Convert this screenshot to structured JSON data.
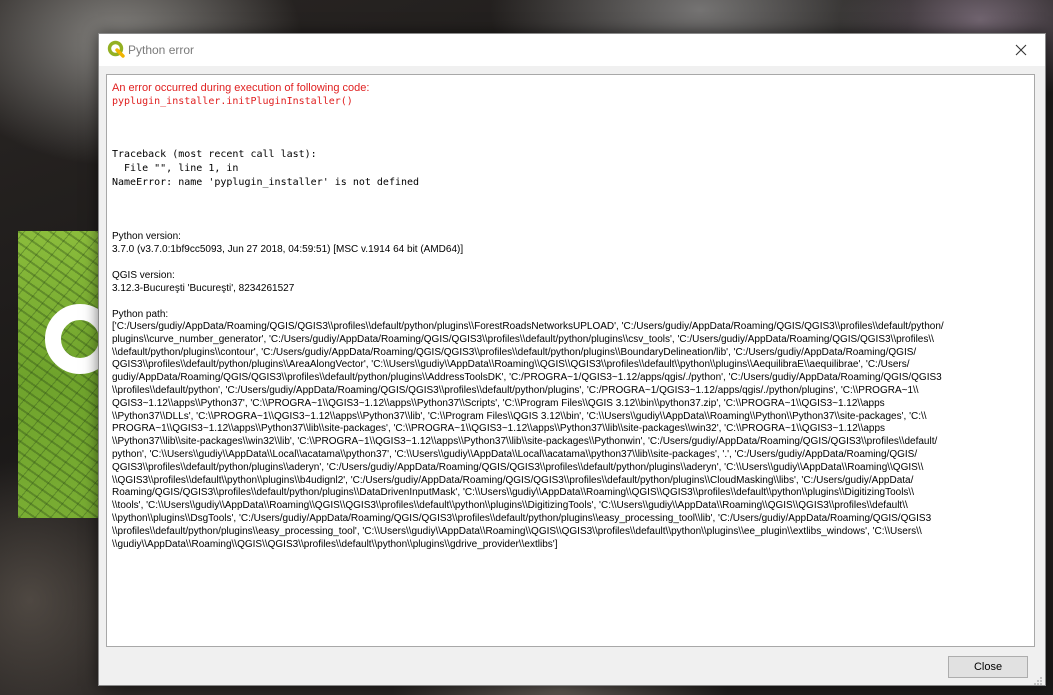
{
  "window": {
    "title": "Python error",
    "app_icon": "qgis-logo-icon",
    "close_icon": "close-icon"
  },
  "error": {
    "heading": "An error occurred during execution of following code:",
    "code": "pyplugin_installer.initPluginInstaller()"
  },
  "traceback": [
    "Traceback (most recent call last):",
    "  File \"\", line 1, in",
    "NameError: name 'pyplugin_installer' is not defined"
  ],
  "python_version": {
    "label": "Python version:",
    "value": "3.7.0 (v3.7.0:1bf9cc5093, Jun 27 2018, 04:59:51) [MSC v.1914 64 bit (AMD64)]"
  },
  "qgis_version": {
    "label": "QGIS version:",
    "value": "3.12.3-Bucureşti 'Bucureşti', 8234261527"
  },
  "python_path": {
    "label": "Python path:",
    "lines": [
      "['C:/Users/gudiy/AppData/Roaming/QGIS/QGIS3\\\\profiles\\\\default/python/plugins\\\\ForestRoadsNetworksUPLOAD', 'C:/Users/gudiy/AppData/Roaming/QGIS/QGIS3\\\\profiles\\\\default/python/",
      "plugins\\\\curve_number_generator', 'C:/Users/gudiy/AppData/Roaming/QGIS/QGIS3\\\\profiles\\\\default/python/plugins\\\\csv_tools', 'C:/Users/gudiy/AppData/Roaming/QGIS/QGIS3\\\\profiles\\\\",
      "\\\\default/python/plugins\\\\contour', 'C:/Users/gudiy/AppData/Roaming/QGIS/QGIS3\\\\profiles\\\\default/python/plugins\\\\BoundaryDelineation/lib', 'C:/Users/gudiy/AppData/Roaming/QGIS/",
      "QGIS3\\\\profiles\\\\default/python/plugins\\\\AreaAlongVector', 'C:\\\\Users\\\\gudiy\\\\AppData\\\\Roaming\\\\QGIS\\\\QGIS3\\\\profiles\\\\default\\\\python\\\\plugins\\\\AequilibraE\\\\aequilibrae', 'C:/Users/",
      "gudiy/AppData/Roaming/QGIS/QGIS3\\\\profiles\\\\default/python/plugins\\\\AddressToolsDK', 'C:/PROGRA~1/QGIS3~1.12/apps/qgis/./python', 'C:/Users/gudiy/AppData/Roaming/QGIS/QGIS3",
      "\\\\profiles\\\\default/python', 'C:/Users/gudiy/AppData/Roaming/QGIS/QGIS3\\\\profiles\\\\default/python/plugins', 'C:/PROGRA~1/QGIS3~1.12/apps/qgis/./python/plugins', 'C:\\\\PROGRA~1\\\\",
      "QGIS3~1.12\\\\apps\\\\Python37', 'C:\\\\PROGRA~1\\\\QGIS3~1.12\\\\apps\\\\Python37\\\\Scripts', 'C:\\\\Program Files\\\\QGIS 3.12\\\\bin\\\\python37.zip', 'C:\\\\PROGRA~1\\\\QGIS3~1.12\\\\apps",
      "\\\\Python37\\\\DLLs', 'C:\\\\PROGRA~1\\\\QGIS3~1.12\\\\apps\\\\Python37\\\\lib', 'C:\\\\Program Files\\\\QGIS 3.12\\\\bin', 'C:\\\\Users\\\\gudiy\\\\AppData\\\\Roaming\\\\Python\\\\Python37\\\\site-packages', 'C:\\\\",
      "PROGRA~1\\\\QGIS3~1.12\\\\apps\\\\Python37\\\\lib\\\\site-packages', 'C:\\\\PROGRA~1\\\\QGIS3~1.12\\\\apps\\\\Python37\\\\lib\\\\site-packages\\\\win32', 'C:\\\\PROGRA~1\\\\QGIS3~1.12\\\\apps",
      "\\\\Python37\\\\lib\\\\site-packages\\\\win32\\\\lib', 'C:\\\\PROGRA~1\\\\QGIS3~1.12\\\\apps\\\\Python37\\\\lib\\\\site-packages\\\\Pythonwin', 'C:/Users/gudiy/AppData/Roaming/QGIS/QGIS3\\\\profiles\\\\default/",
      "python', 'C:\\\\Users\\\\gudiy\\\\AppData\\\\Local\\\\acatama\\\\python37', 'C:\\\\Users\\\\gudiy\\\\AppData\\\\Local\\\\acatama\\\\python37\\\\lib\\\\site-packages', '.', 'C:/Users/gudiy/AppData/Roaming/QGIS/",
      "QGIS3\\\\profiles\\\\default/python/plugins\\\\aderyn', 'C:/Users/gudiy/AppData/Roaming/QGIS/QGIS3\\\\profiles\\\\default/python/plugins\\\\aderyn', 'C:\\\\Users\\\\gudiy\\\\AppData\\\\Roaming\\\\QGIS\\\\",
      "\\\\QGIS3\\\\profiles\\\\default\\\\python\\\\plugins\\\\b4udignl2', 'C:/Users/gudiy/AppData/Roaming/QGIS/QGIS3\\\\profiles\\\\default/python/plugins\\\\CloudMasking\\\\libs', 'C:/Users/gudiy/AppData/",
      "Roaming/QGIS/QGIS3\\\\profiles\\\\default/python/plugins\\\\DataDrivenInputMask', 'C:\\\\Users\\\\gudiy\\\\AppData\\\\Roaming\\\\QGIS\\\\QGIS3\\\\profiles\\\\default\\\\python\\\\plugins\\\\DigitizingTools\\\\",
      "\\\\tools', 'C:\\\\Users\\\\gudiy\\\\AppData\\\\Roaming\\\\QGIS\\\\QGIS3\\\\profiles\\\\default\\\\python\\\\plugins\\\\DigitizingTools', 'C:\\\\Users\\\\gudiy\\\\AppData\\\\Roaming\\\\QGIS\\\\QGIS3\\\\profiles\\\\default\\\\",
      "\\\\python\\\\plugins\\\\DsgTools', 'C:/Users/gudiy/AppData/Roaming/QGIS/QGIS3\\\\profiles\\\\default/python/plugins\\\\easy_processing_tool\\\\lib', 'C:/Users/gudiy/AppData/Roaming/QGIS/QGIS3",
      "\\\\profiles\\\\default/python/plugins\\\\easy_processing_tool', 'C:\\\\Users\\\\gudiy\\\\AppData\\\\Roaming\\\\QGIS\\\\QGIS3\\\\profiles\\\\default\\\\python\\\\plugins\\\\ee_plugin\\\\extlibs_windows', 'C:\\\\Users\\\\",
      "\\\\gudiy\\\\AppData\\\\Roaming\\\\QGIS\\\\QGIS3\\\\profiles\\\\default\\\\python\\\\plugins\\\\gdrive_provider\\\\extlibs']"
    ]
  },
  "buttons": {
    "close_label": "Close"
  }
}
